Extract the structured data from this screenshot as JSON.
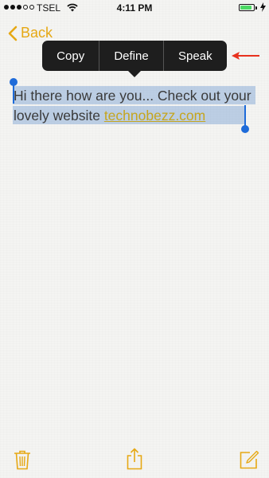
{
  "status_bar": {
    "carrier": "TSEL",
    "time": "4:11 PM",
    "signal_bars_filled": 3,
    "signal_bars_total": 5,
    "battery_level": 0.9
  },
  "nav": {
    "back_label": "Back"
  },
  "context_menu": {
    "items": [
      "Copy",
      "Define",
      "Speak"
    ]
  },
  "note": {
    "text_part1": "Hi there how are you... Check out your lovely website ",
    "link_text": "technobezz.com"
  },
  "colors": {
    "accent": "#e6a814",
    "selection": "#78a0d2",
    "handle": "#1e6bd9",
    "annotation_arrow": "#e8321e",
    "menu_bg": "#1e1e1e"
  },
  "toolbar": {
    "icons": [
      "trash-icon",
      "share-icon",
      "compose-icon"
    ]
  }
}
